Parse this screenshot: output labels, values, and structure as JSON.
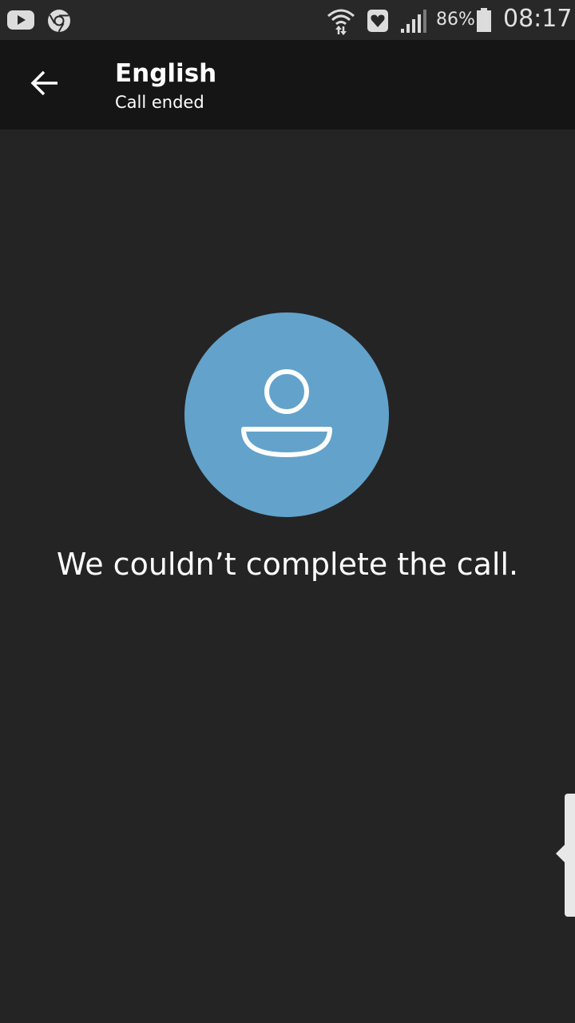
{
  "status_bar": {
    "battery_percent": "86%",
    "time": "08:17",
    "icons": [
      "youtube-icon",
      "chrome-icon",
      "wifi-icon",
      "health-icon",
      "signal-icon",
      "battery-icon"
    ]
  },
  "app_bar": {
    "title": "English",
    "subtitle": "Call ended",
    "back_icon": "arrow-left-icon"
  },
  "main": {
    "avatar_icon": "person-icon",
    "avatar_color": "#62a2cb",
    "message": "We couldn’t complete the call."
  },
  "colors": {
    "background": "#242424",
    "app_bar": "#151515",
    "status_bar": "#282828"
  }
}
